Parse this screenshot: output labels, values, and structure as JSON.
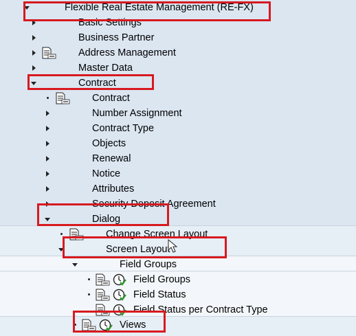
{
  "tree": {
    "root": {
      "label": "Flexible Real Estate Management (RE-FX)",
      "expanded": true
    },
    "items": [
      {
        "label": "Basic Settings",
        "level": 1,
        "icon": "triangle-right"
      },
      {
        "label": "Business Partner",
        "level": 1,
        "icon": "triangle-right"
      },
      {
        "label": "Address Management",
        "level": 1,
        "icon": "triangle-right",
        "doc": "img-doc-icon"
      },
      {
        "label": "Master Data",
        "level": 1,
        "icon": "triangle-right"
      },
      {
        "label": "Contract",
        "level": 1,
        "icon": "triangle-down",
        "expanded": true
      },
      {
        "label": "Contract",
        "level": 2,
        "doc": "img-doc-icon"
      },
      {
        "label": "Number Assignment",
        "level": 2,
        "icon": "triangle-right"
      },
      {
        "label": "Contract Type",
        "level": 2,
        "icon": "triangle-right"
      },
      {
        "label": "Objects",
        "level": 2,
        "icon": "triangle-right"
      },
      {
        "label": "Renewal",
        "level": 2,
        "icon": "triangle-right"
      },
      {
        "label": "Notice",
        "level": 2,
        "icon": "triangle-right"
      },
      {
        "label": "Attributes",
        "level": 2,
        "icon": "triangle-right"
      },
      {
        "label": "Security Deposit Agreement",
        "level": 2,
        "icon": "triangle-right"
      },
      {
        "label": "Dialog",
        "level": 2,
        "icon": "triangle-down",
        "expanded": true
      },
      {
        "label": "Change Screen Layout",
        "level": 3,
        "doc": "img-doc-icon"
      },
      {
        "label": "Screen Layout",
        "level": 3,
        "icon": "triangle-down",
        "expanded": true
      },
      {
        "label": "Field Groups",
        "level": 4,
        "icon": "triangle-down",
        "expanded": true
      },
      {
        "label": "Field Groups",
        "level": 5,
        "doc": "img-doc-icon",
        "clock": "clock-check-icon"
      },
      {
        "label": "Field Status",
        "level": 5,
        "doc": "img-doc-icon",
        "clock": "clock-check-icon"
      },
      {
        "label": "Field Status per Contract Type",
        "level": 5,
        "doc": "img-doc-icon",
        "clock": "clock-check-icon"
      },
      {
        "label": "Views",
        "level": 4,
        "doc": "img-doc-icon",
        "clock": "clock-check-icon"
      }
    ]
  },
  "highlight_color": "#d7191f",
  "background_color": "#dbe6f1"
}
